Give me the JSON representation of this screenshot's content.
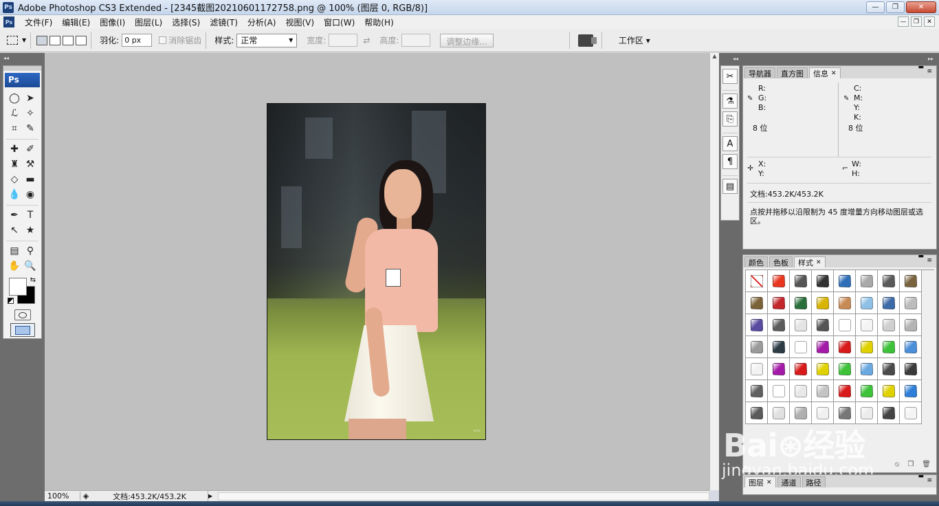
{
  "window": {
    "title": "Adobe Photoshop CS3 Extended - [2345截图20210601172758.png @ 100% (图层 0, RGB/8)]",
    "controls": {
      "minimize": "—",
      "maximize": "❐",
      "close": "✕"
    },
    "doc_controls": {
      "minimize": "—",
      "restore": "❐",
      "close": "✕"
    }
  },
  "menu": {
    "ps_icon": "Ps",
    "items": [
      "文件(F)",
      "编辑(E)",
      "图像(I)",
      "图层(L)",
      "选择(S)",
      "滤镜(T)",
      "分析(A)",
      "视图(V)",
      "窗口(W)",
      "帮助(H)"
    ]
  },
  "options": {
    "feather_label": "羽化:",
    "feather_value": "0 px",
    "antialias_label": "消除锯齿",
    "style_label": "样式:",
    "style_value": "正常",
    "width_label": "宽度:",
    "height_label": "高度:",
    "refine_edge": "调整边缘...",
    "workspace": "工作区 ▾"
  },
  "tools": {
    "logo": "Ps",
    "rows": [
      [
        "◯",
        "➤"
      ],
      [
        "ℒ",
        "✧"
      ],
      [
        "⌗",
        "✎"
      ],
      [
        "✚",
        "✐"
      ],
      [
        "♜",
        "⚒"
      ],
      [
        "◇",
        "▬"
      ],
      [
        "💧",
        "◉"
      ],
      [
        "✒",
        "T"
      ],
      [
        "↖",
        "★"
      ],
      [
        "▤",
        "⚲"
      ],
      [
        "✋",
        "🔍"
      ]
    ],
    "icon_names": [
      [
        "ellipse-marquee-icon",
        "move-icon"
      ],
      [
        "lasso-icon",
        "magic-wand-icon"
      ],
      [
        "crop-icon",
        "slice-icon"
      ],
      [
        "healing-brush-icon",
        "brush-icon"
      ],
      [
        "clone-stamp-icon",
        "history-brush-icon"
      ],
      [
        "eraser-icon",
        "gradient-icon"
      ],
      [
        "blur-icon",
        "dodge-icon"
      ],
      [
        "pen-icon",
        "type-icon"
      ],
      [
        "path-select-icon",
        "custom-shape-icon"
      ],
      [
        "notes-icon",
        "eyedropper-icon"
      ],
      [
        "hand-icon",
        "zoom-icon"
      ]
    ]
  },
  "status": {
    "zoom": "100%",
    "doc_size": "文档:453.2K/453.2K"
  },
  "dock": {
    "icons": [
      "✂",
      "⚗",
      "⎘",
      "A",
      "¶",
      "▤"
    ],
    "icon_names": [
      "tool-presets-icon",
      "brushes-icon",
      "clone-source-icon",
      "character-icon",
      "paragraph-icon",
      "layer-comps-icon"
    ]
  },
  "info_panel": {
    "tabs": [
      "导航器",
      "直方图",
      "信息"
    ],
    "active_tab": "信息",
    "rgb": {
      "r": "R:",
      "g": "G:",
      "b": "B:",
      "bits": "8 位"
    },
    "cmyk": {
      "c": "C:",
      "m": "M:",
      "y": "Y:",
      "k": "K:",
      "bits": "8 位"
    },
    "xy": {
      "x": "X:",
      "y": "Y:"
    },
    "wh": {
      "w": "W:",
      "h": "H:"
    },
    "doc": "文档:453.2K/453.2K",
    "hint": "点按并拖移以沿限制为 45 度增量方向移动图层或选区。"
  },
  "styles_panel": {
    "tabs": [
      "颜色",
      "色板",
      "样式"
    ],
    "active_tab": "样式",
    "swatches": [
      "none",
      "#e8361f",
      "#555555",
      "#333333",
      "#2f6fb8",
      "#a8a8a8",
      "#5a5a5a",
      "#7a6440",
      "#7c6238",
      "#c3262b",
      "#2a6e3a",
      "#d8b300",
      "#c98b56",
      "#8fc0e6",
      "#3d6aa8",
      "#bcbcbc",
      "#5a4aa0",
      "#5c5c5c",
      "#e4e4e4",
      "#555555",
      "#ffffff",
      "#f4f4f4",
      "#cfcfcf",
      "#b4b4b4",
      "#9a9a9a",
      "#2d3b45",
      "#ffffff",
      "#a31aa8",
      "#d81a1a",
      "#e0d200",
      "#3ec23a",
      "#4b8fd9",
      "#f2f2f2",
      "#a31aa8",
      "#d81a1a",
      "#e0d200",
      "#3ec23a",
      "#6aa8e0",
      "#4a4a4a",
      "#3a3a3a",
      "#606060",
      "#ffffff",
      "#e8e8e8",
      "#c4c4c4",
      "#d81a1a",
      "#3ec23a",
      "#e0d200",
      "#2f7fd8",
      "#5a5a5a",
      "#e0e0e0",
      "#b0b0b0",
      "#f0f0f0",
      "#777777",
      "#ececec",
      "#444444",
      "#f4f4f4"
    ]
  },
  "layers_panel": {
    "tabs": [
      "图层",
      "通道",
      "路径"
    ],
    "active_tab": "图层"
  },
  "watermark": {
    "logo": "Bai⊛经验",
    "url": "jingyan.baidu.com"
  }
}
